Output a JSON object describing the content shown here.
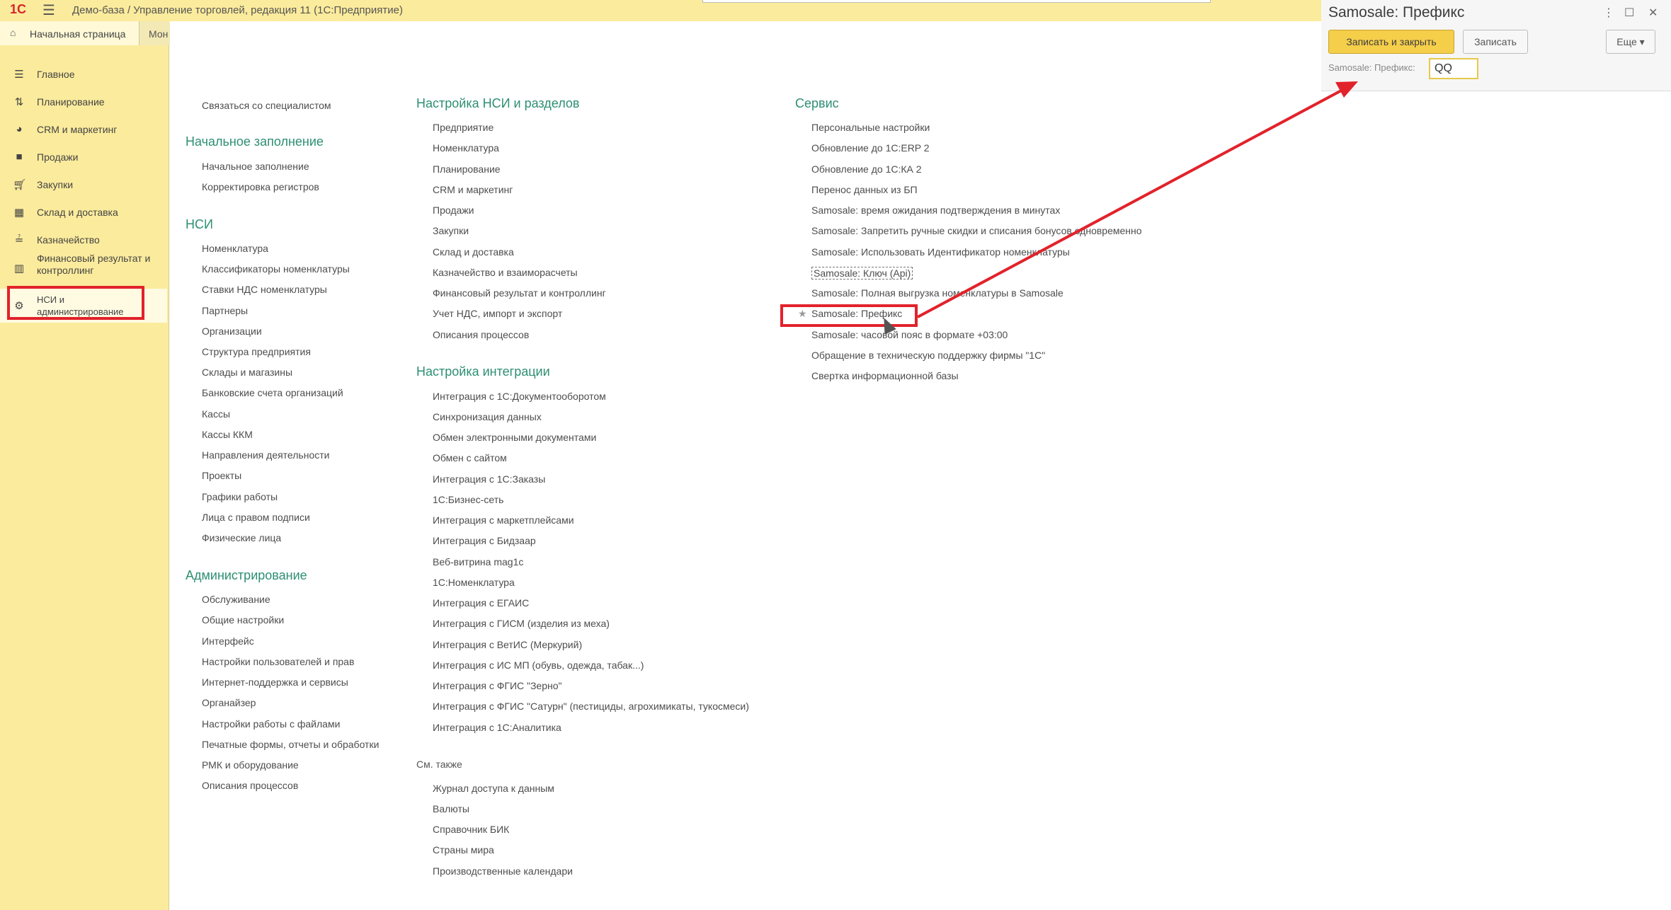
{
  "window": {
    "logo": "1С",
    "title": "Демо-база / Управление торговлей, редакция 11  (1С:Предприятие)",
    "home_tab": "Начальная страница",
    "more_tab": "Мон"
  },
  "sidebar": {
    "items": [
      {
        "label": "Главное",
        "icon": "list-icon"
      },
      {
        "label": "Планирование",
        "icon": "planning-icon"
      },
      {
        "label": "CRM и маркетинг",
        "icon": "pie-icon"
      },
      {
        "label": "Продажи",
        "icon": "bag-icon"
      },
      {
        "label": "Закупки",
        "icon": "cart-icon"
      },
      {
        "label": "Склад и доставка",
        "icon": "grid-icon"
      },
      {
        "label": "Казначейство",
        "icon": "treasury-icon"
      },
      {
        "label": "Финансовый результат и контроллинг",
        "icon": "bar-chart-icon"
      },
      {
        "label": "НСИ и администрирование",
        "icon": "gear-icon"
      }
    ]
  },
  "col1": {
    "top_link": "Связаться со специалистом",
    "sections": [
      {
        "title": "Начальное заполнение",
        "items": [
          "Начальное заполнение",
          "Корректировка регистров"
        ]
      },
      {
        "title": "НСИ",
        "items": [
          "Номенклатура",
          "Классификаторы номенклатуры",
          "Ставки НДС номенклатуры",
          "Партнеры",
          "Организации",
          "Структура предприятия",
          "Склады и магазины",
          "Банковские счета организаций",
          "Кассы",
          "Кассы ККМ",
          "Направления деятельности",
          "Проекты",
          "Графики работы",
          "Лица с правом подписи",
          "Физические лица"
        ]
      },
      {
        "title": "Администрирование",
        "items": [
          "Обслуживание",
          "Общие настройки",
          "Интерфейс",
          "Настройки пользователей и прав",
          "Интернет-поддержка и сервисы",
          "Органайзер",
          "Настройки работы с файлами",
          "Печатные формы, отчеты и обработки",
          "РМК и оборудование",
          "Описания процессов"
        ]
      }
    ]
  },
  "col2": {
    "sections": [
      {
        "title": "Настройка НСИ и разделов",
        "items": [
          "Предприятие",
          "Номенклатура",
          "Планирование",
          "CRM и маркетинг",
          "Продажи",
          "Закупки",
          "Склад и доставка",
          "Казначейство и взаиморасчеты",
          "Финансовый результат и контроллинг",
          "Учет НДС, импорт и экспорт",
          "Описания процессов"
        ]
      },
      {
        "title": "Настройка интеграции",
        "items": [
          "Интеграция с 1С:Документооборотом",
          "Синхронизация данных",
          "Обмен электронными документами",
          "Обмен с сайтом",
          "Интеграция с 1С:Заказы",
          "1С:Бизнес-сеть",
          "Интеграция с маркетплейсами",
          "Интеграция с Бидзаар",
          "Веб-витрина mag1c",
          "1С:Номенклатура",
          "Интеграция с ЕГАИС",
          "Интеграция с ГИСМ (изделия из меха)",
          "Интеграция с ВетИС (Меркурий)",
          "Интеграция с ИС МП (обувь, одежда, табак...)",
          "Интеграция с ФГИС \"Зерно\"",
          "Интеграция с ФГИС \"Сатурн\" (пестициды, агрохимикаты, тукосмеси)",
          "Интеграция с 1С:Аналитика"
        ]
      },
      {
        "title": "См. также",
        "items": [
          "Журнал доступа к данным",
          "Валюты",
          "Справочник БИК",
          "Страны мира",
          "Производственные календари"
        ]
      }
    ]
  },
  "col3": {
    "title": "Сервис",
    "items": [
      "Персональные настройки",
      "Обновление до 1С:ERP 2",
      "Обновление до 1С:КА 2",
      "Перенос данных из БП",
      "Samosale: время ожидания подтверждения в минутах",
      "Samosale: Запретить ручные скидки и списания бонусов одновременно",
      "Samosale: Использовать Идентификатор номенклатуры",
      "Samosale: Ключ (Api)",
      "Samosale: Полная выгрузка номенклатуры в Samosale",
      "Samosale: Префикс",
      "Samosale: часовой пояс в формате +03:00",
      "Обращение в техническую поддержку фирмы \"1С\"",
      "Свертка информационной базы"
    ],
    "favorite_star": "★"
  },
  "dialog": {
    "title": "Samosale: Префикс",
    "save_close": "Записать и закрыть",
    "save": "Записать",
    "more": "Еще ▾",
    "field_label": "Samosale: Префикс:",
    "field_value": "QQ",
    "ctrl_menu": "⋮",
    "ctrl_max": "☐",
    "ctrl_close": "✕"
  },
  "colors": {
    "accent_yellow": "#fbeb9c",
    "section_green": "#2d8f72",
    "highlight_red": "#e2222b",
    "primary_button": "#f5ce4a"
  }
}
